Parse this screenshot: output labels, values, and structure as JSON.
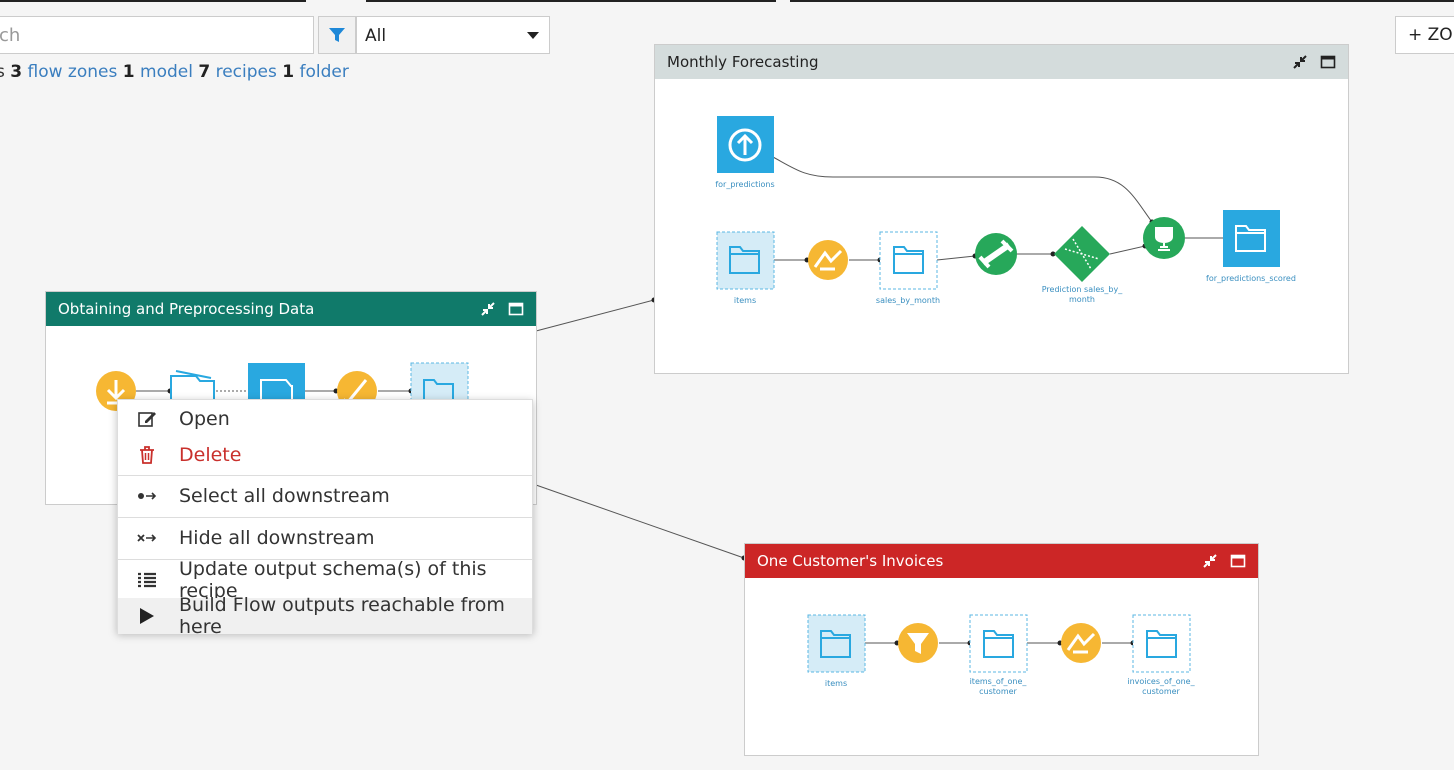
{
  "toolbar": {
    "search_placeholder": "ch",
    "filter_value": "All",
    "add_zone_label": "+ ZON"
  },
  "counts": {
    "prefix": "s",
    "flow_zones_count": "3",
    "flow_zones_label": "flow zones",
    "models_count": "1",
    "models_label": "model",
    "recipes_count": "7",
    "recipes_label": "recipes",
    "folders_count": "1",
    "folders_label": "folder"
  },
  "zones": {
    "obtaining": {
      "title": "Obtaining and Preprocessing Data",
      "color": "#107a6a"
    },
    "monthly": {
      "title": "Monthly Forecasting",
      "color": "#d4dcdc",
      "nodes": {
        "for_predictions": "for_predictions",
        "items": "items",
        "sales_by_month": "sales_by_month",
        "prediction_line1": "Prediction sales_by_",
        "prediction_line2": "month",
        "for_predictions_scored": "for_predictions_scored"
      }
    },
    "invoices": {
      "title": "One Customer's Invoices",
      "color": "#cc2626",
      "nodes": {
        "items": "items",
        "items_of_one_line1": "items_of_one_",
        "items_of_one_line2": "customer",
        "invoices_of_one_line1": "invoices_of_one_",
        "invoices_of_one_line2": "customer"
      }
    }
  },
  "context_menu": {
    "open": "Open",
    "delete": "Delete",
    "select_downstream": "Select all downstream",
    "hide_downstream": "Hide all downstream",
    "update_schema": "Update output schema(s) of this recipe",
    "build_outputs": "Build Flow outputs reachable from here"
  },
  "colors": {
    "dataset_blue": "#29a8e0",
    "recipe_yellow": "#f6b733",
    "model_green": "#27a85a",
    "delete_red": "#c9302c",
    "link_blue": "#3a7ebf"
  }
}
